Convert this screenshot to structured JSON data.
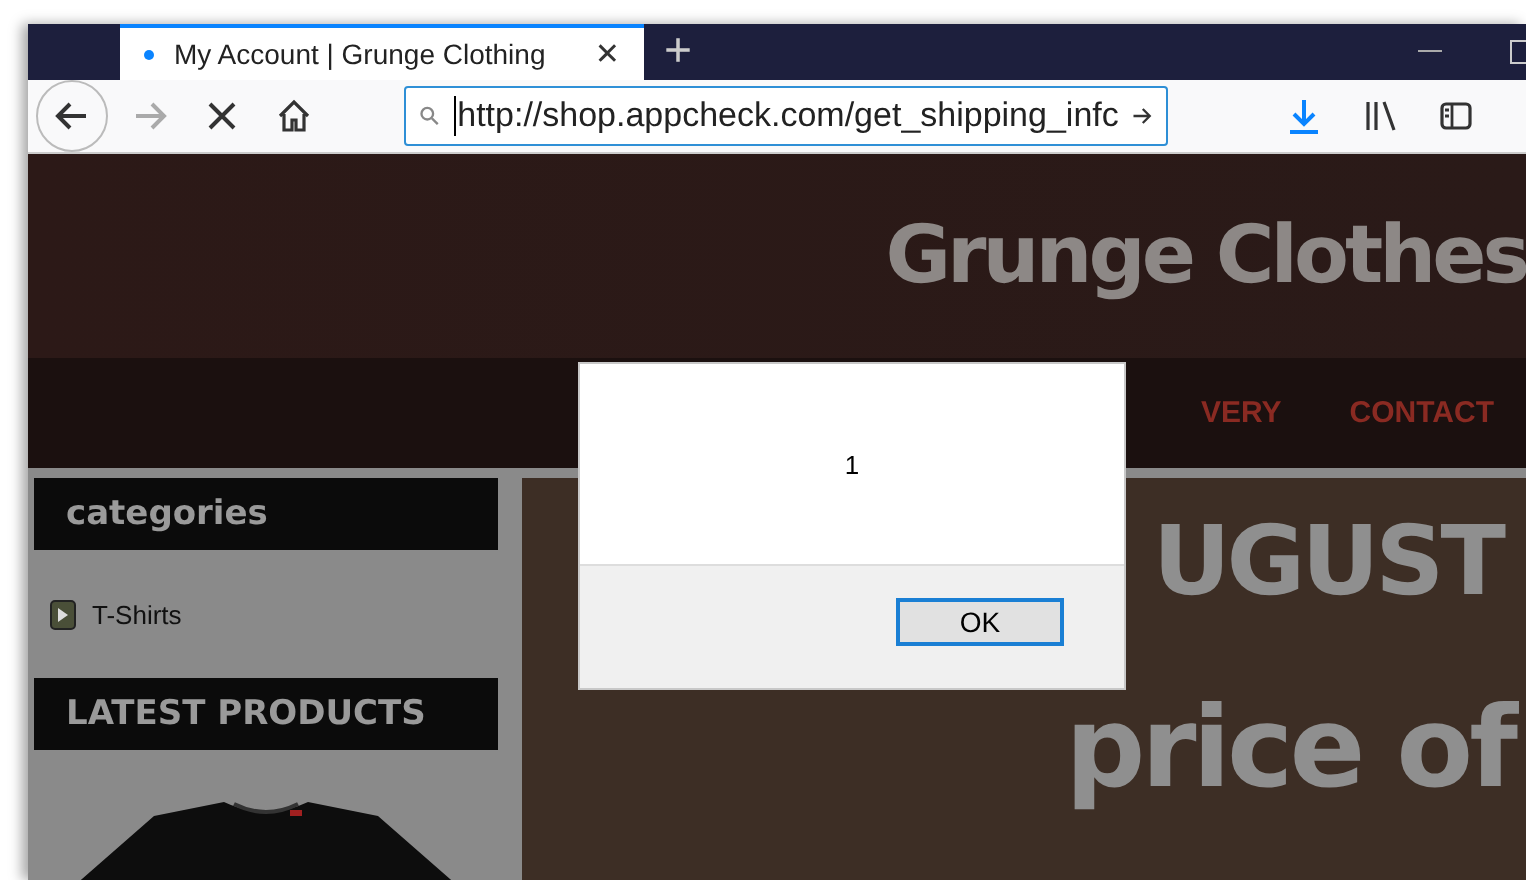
{
  "browser": {
    "tabs": [
      {
        "title": "My Account | Grunge Clothing",
        "selected": true,
        "loading": true,
        "close": "✕"
      }
    ],
    "new_tab": "+",
    "address": "http://shop.appcheck.com/get_shipping_infc"
  },
  "site": {
    "logo": "Grunge Clothes",
    "nav": [
      "VERY",
      "CONTACT"
    ],
    "sidebar": [
      {
        "kind": "heading",
        "text": "categories"
      },
      {
        "kind": "link",
        "text": "T-Shirts"
      },
      {
        "kind": "heading",
        "text": "LATEST PRODUCTS"
      },
      {
        "kind": "product"
      }
    ],
    "banner": [
      "UGUST",
      "price of"
    ]
  },
  "dialog": {
    "message": "1",
    "button": "OK"
  }
}
